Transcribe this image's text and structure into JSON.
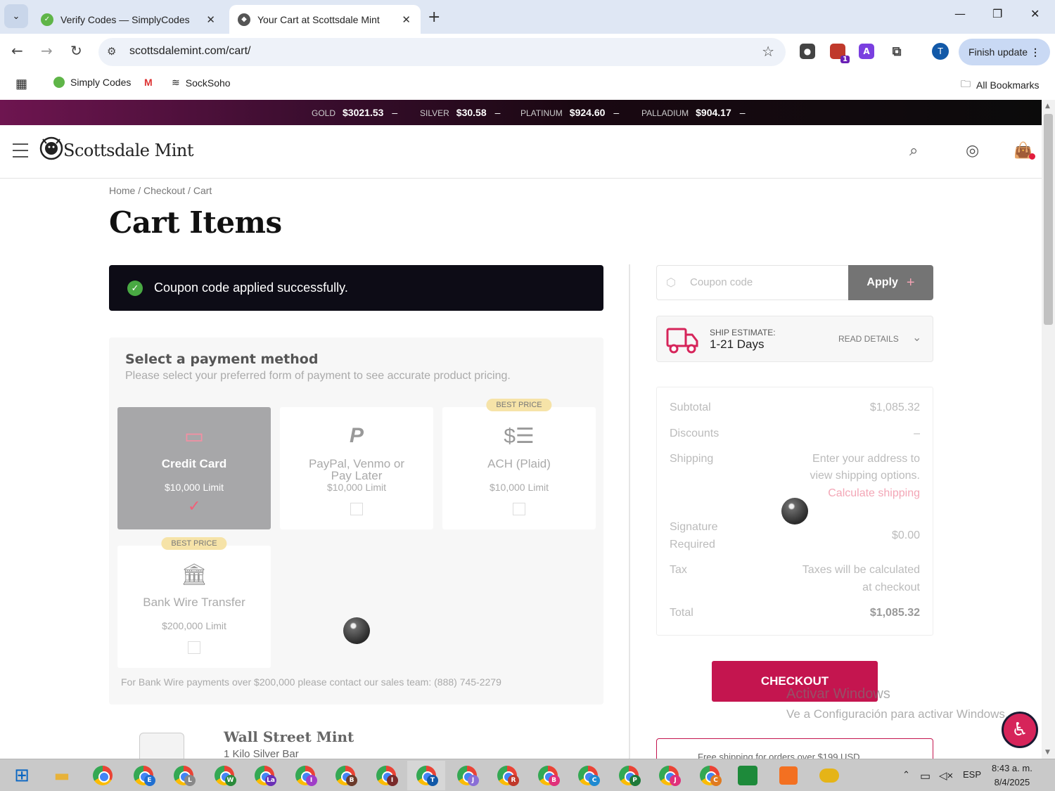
{
  "browser": {
    "tabs": [
      {
        "title": "Verify Codes — SimplyCodes",
        "active": false
      },
      {
        "title": "Your Cart at Scottsdale Mint",
        "active": true
      }
    ],
    "url": "scottsdalemint.com/cart/",
    "finish_update": "Finish update",
    "profile_initial": "T",
    "ext_badge": "1",
    "ext_letter": "A",
    "bookmarks": [
      "Simply Codes",
      "SockSoho"
    ],
    "all_bookmarks": "All Bookmarks"
  },
  "ticker": [
    {
      "metal": "GOLD",
      "price": "$3021.53",
      "dash": "–"
    },
    {
      "metal": "SILVER",
      "price": "$30.58",
      "dash": "–"
    },
    {
      "metal": "PLATINUM",
      "price": "$924.60",
      "dash": "–"
    },
    {
      "metal": "PALLADIUM",
      "price": "$904.17",
      "dash": "–"
    }
  ],
  "site": {
    "name": "Scottsdale Mint"
  },
  "page": {
    "breadcrumb": "Home / Checkout / Cart",
    "title": "Cart Items",
    "notice": "Coupon code applied successfully."
  },
  "payment": {
    "heading": "Select a payment method",
    "subheading": "Please select your preferred form of payment to see accurate product pricing.",
    "methods": [
      {
        "label": "Credit Card",
        "limit": "$10,000 Limit",
        "selected": true,
        "badge": ""
      },
      {
        "label": "PayPal, Venmo or Pay Later",
        "limit": "$10,000 Limit",
        "selected": false,
        "badge": ""
      },
      {
        "label": "ACH (Plaid)",
        "limit": "$10,000 Limit",
        "selected": false,
        "badge": "BEST PRICE"
      },
      {
        "label": "Bank Wire Transfer",
        "limit": "$200,000 Limit",
        "selected": false,
        "badge": "BEST PRICE"
      }
    ],
    "note": "For Bank Wire payments over $200,000 please contact our sales team: (888) 745-2279"
  },
  "product": {
    "brand": "Wall Street Mint",
    "name": "1 Kilo Silver Bar"
  },
  "coupon": {
    "placeholder": "Coupon code",
    "apply": "Apply"
  },
  "ship": {
    "label": "SHIP ESTIMATE:",
    "value": "1-21 Days",
    "details": "READ DETAILS"
  },
  "summary": {
    "subtotal_label": "Subtotal",
    "subtotal": "$1,085.32",
    "discounts_label": "Discounts",
    "discounts": "–",
    "shipping_label": "Shipping",
    "shipping_line1": "Enter your address to",
    "shipping_line2": "view shipping options.",
    "shipping_link": "Calculate shipping",
    "signature_label1": "Signature",
    "signature_label2": "Required",
    "signature": "$0.00",
    "tax_label": "Tax",
    "tax_line1": "Taxes will be calculated",
    "tax_line2": "at checkout",
    "total_label": "Total",
    "total": "$1,085.32"
  },
  "checkout": "CHECKOUT",
  "free_shipping": "Free shipping for orders over $199 USD",
  "watermark": {
    "line1": "Activar Windows",
    "line2": "Ve a Configuración para activar Windows."
  },
  "taskbar": {
    "badges": [
      "",
      "E",
      "L",
      "W",
      "La",
      "I",
      "B",
      "I",
      "T",
      "J",
      "R",
      "B",
      "C",
      "P",
      "J",
      "C"
    ],
    "lang": "ESP",
    "time": "8:43 a. m.",
    "date": "8/4/2025"
  },
  "colors": {
    "accent": "#c4154f",
    "ticker_start": "#6e1550",
    "selected_card": "#a7a7a9",
    "success": "#49a943"
  }
}
